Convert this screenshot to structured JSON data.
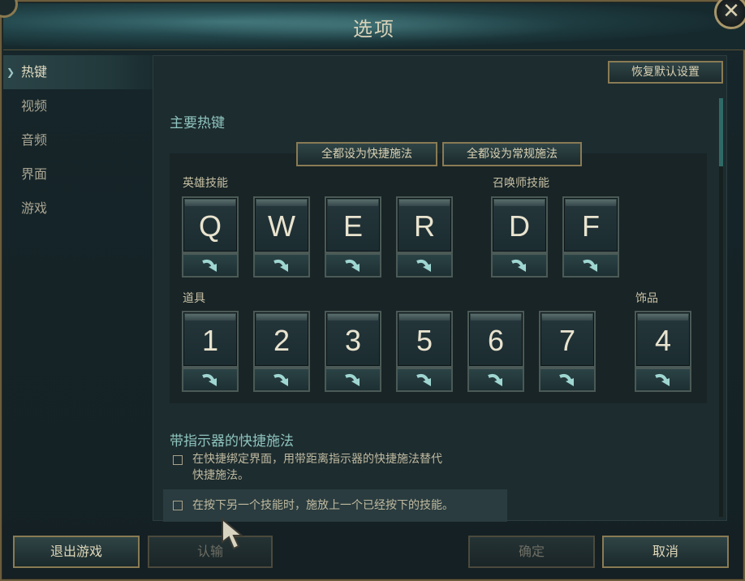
{
  "window": {
    "title": "选项",
    "close_glyph": "✕"
  },
  "sidebar": {
    "items": [
      {
        "label": "热键",
        "active": true
      },
      {
        "label": "视频"
      },
      {
        "label": "音频"
      },
      {
        "label": "界面"
      },
      {
        "label": "游戏"
      }
    ]
  },
  "panel": {
    "restore_label": "恢复默认设置",
    "section_title": "主要热键",
    "set_quick_label": "全都设为快捷施法",
    "set_normal_label": "全都设为常规施法",
    "groups": {
      "champion": "英雄技能",
      "summoner": "召唤师技能",
      "items": "道具",
      "trinket": "饰品"
    },
    "champion_keys": [
      "Q",
      "W",
      "E",
      "R"
    ],
    "summoner_keys": [
      "D",
      "F"
    ],
    "item_keys": [
      "1",
      "2",
      "3",
      "5",
      "6",
      "7"
    ],
    "trinket_key": "4",
    "quickcast_title": "带指示器的快捷施法",
    "option1_line1": "在快捷绑定界面，用带距离指示器的快捷施法替代",
    "option1_line2": "快捷施法。",
    "option2": "在按下另一个技能时，施放上一个已经按下的技能。"
  },
  "footer": {
    "exit_label": "退出游戏",
    "surrender_label": "认输",
    "ok_label": "确定",
    "cancel_label": "取消"
  },
  "colors": {
    "accent": "#8fc4be",
    "border_gold": "#8a7b54",
    "text": "#c9c3a8"
  }
}
